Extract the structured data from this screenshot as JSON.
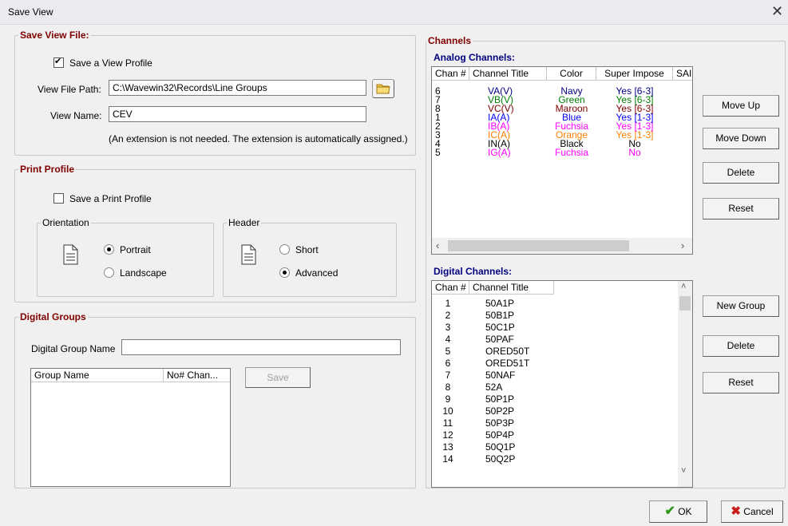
{
  "window": {
    "title": "Save View",
    "close_glyph": "✕"
  },
  "save_view_file": {
    "legend": "Save View File:",
    "save_profile_label": "Save a View Profile",
    "save_profile_checked": true,
    "path_label": "View File Path:",
    "path_value": "C:\\Wavewin32\\Records\\Line Groups",
    "name_label": "View Name:",
    "name_value": "CEV",
    "note": "(An extension is not needed. The extension is automatically assigned.)"
  },
  "print_profile": {
    "legend": "Print Profile",
    "save_label": "Save a Print Profile",
    "save_checked": false,
    "orientation": {
      "legend": "Orientation",
      "portrait": "Portrait",
      "landscape": "Landscape",
      "selected": "Portrait"
    },
    "header": {
      "legend": "Header",
      "short": "Short",
      "advanced": "Advanced",
      "selected": "Advanced"
    }
  },
  "digital_groups": {
    "legend": "Digital Groups",
    "name_label": "Digital Group Name",
    "name_value": "",
    "col_group_name": "Group Name",
    "col_num_chan": "No# Chan...",
    "save_button": "Save"
  },
  "channels": {
    "legend": "Channels",
    "analog_title": "Analog Channels:",
    "analog_headers": [
      "Chan #",
      "Channel Title",
      "Color",
      "Super Impose",
      "SAI"
    ],
    "analog_rows": [
      {
        "chan": "6",
        "title": "VA(V)",
        "color": "Navy",
        "si": "Yes [6-3]",
        "hex": "#000080"
      },
      {
        "chan": "7",
        "title": "VB(V)",
        "color": "Green",
        "si": "Yes [6-3]",
        "hex": "#008000"
      },
      {
        "chan": "8",
        "title": "VC(V)",
        "color": "Maroon",
        "si": "Yes [6-3]",
        "hex": "#800000"
      },
      {
        "chan": "1",
        "title": "IA(A)",
        "color": "Blue",
        "si": "Yes [1-3]",
        "hex": "#0000ff"
      },
      {
        "chan": "2",
        "title": "IB(A)",
        "color": "Fuchsia",
        "si": "Yes [1-3]",
        "hex": "#ff00ff"
      },
      {
        "chan": "3",
        "title": "IC(A)",
        "color": "Orange",
        "si": "Yes [1-3]",
        "hex": "#ff8000"
      },
      {
        "chan": "4",
        "title": "IN(A)",
        "color": "Black",
        "si": "No",
        "hex": "#000000"
      },
      {
        "chan": "5",
        "title": "IG(A)",
        "color": "Fuchsia",
        "si": "No",
        "hex": "#ff00ff"
      }
    ],
    "analog_buttons": {
      "move_up": "Move Up",
      "move_down": "Move Down",
      "delete": "Delete",
      "reset": "Reset"
    },
    "digital_title": "Digital Channels:",
    "digital_headers": [
      "Chan #",
      "Channel Title"
    ],
    "digital_rows": [
      {
        "chan": "1",
        "title": "50A1P"
      },
      {
        "chan": "2",
        "title": "50B1P"
      },
      {
        "chan": "3",
        "title": "50C1P"
      },
      {
        "chan": "4",
        "title": "50PAF"
      },
      {
        "chan": "5",
        "title": "ORED50T"
      },
      {
        "chan": "6",
        "title": "ORED51T"
      },
      {
        "chan": "7",
        "title": "50NAF"
      },
      {
        "chan": "8",
        "title": "52A"
      },
      {
        "chan": "9",
        "title": "50P1P"
      },
      {
        "chan": "10",
        "title": "50P2P"
      },
      {
        "chan": "11",
        "title": "50P3P"
      },
      {
        "chan": "12",
        "title": "50P4P"
      },
      {
        "chan": "13",
        "title": "50Q1P"
      },
      {
        "chan": "14",
        "title": "50Q2P"
      }
    ],
    "digital_buttons": {
      "new_group": "New Group",
      "delete": "Delete",
      "reset": "Reset"
    }
  },
  "footer": {
    "ok": "OK",
    "cancel": "Cancel"
  },
  "colors": {
    "legend": "#800000",
    "section_title": "#000080",
    "ok_check": "#2e9a1c",
    "cancel_x": "#c81e1e"
  }
}
